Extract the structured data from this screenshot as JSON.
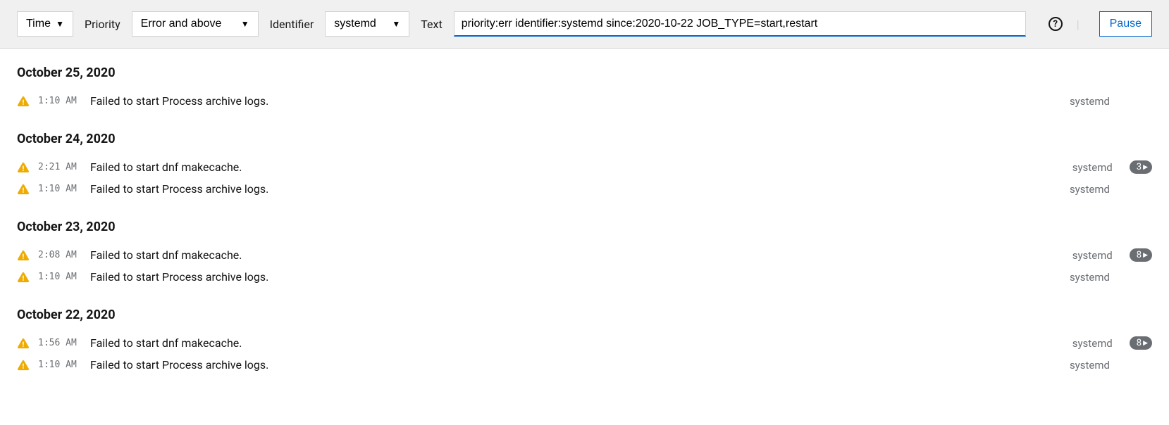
{
  "toolbar": {
    "time_label": "Time",
    "priority_label": "Priority",
    "priority_value": "Error and above",
    "identifier_label": "Identifier",
    "identifier_value": "systemd",
    "text_label": "Text",
    "text_value": "priority:err identifier:systemd since:2020-10-22 JOB_TYPE=start,restart ",
    "pause_label": "Pause"
  },
  "dates": [
    {
      "label": "October 25, 2020",
      "entries": [
        {
          "time": "1:10 AM",
          "msg": "Failed to start Process archive logs.",
          "identifier": "systemd",
          "count": null
        }
      ]
    },
    {
      "label": "October 24, 2020",
      "entries": [
        {
          "time": "2:21 AM",
          "msg": "Failed to start dnf makecache.",
          "identifier": "systemd",
          "count": "3"
        },
        {
          "time": "1:10 AM",
          "msg": "Failed to start Process archive logs.",
          "identifier": "systemd",
          "count": null
        }
      ]
    },
    {
      "label": "October 23, 2020",
      "entries": [
        {
          "time": "2:08 AM",
          "msg": "Failed to start dnf makecache.",
          "identifier": "systemd",
          "count": "8"
        },
        {
          "time": "1:10 AM",
          "msg": "Failed to start Process archive logs.",
          "identifier": "systemd",
          "count": null
        }
      ]
    },
    {
      "label": "October 22, 2020",
      "entries": [
        {
          "time": "1:56 AM",
          "msg": "Failed to start dnf makecache.",
          "identifier": "systemd",
          "count": "8"
        },
        {
          "time": "1:10 AM",
          "msg": "Failed to start Process archive logs.",
          "identifier": "systemd",
          "count": null
        }
      ]
    }
  ]
}
